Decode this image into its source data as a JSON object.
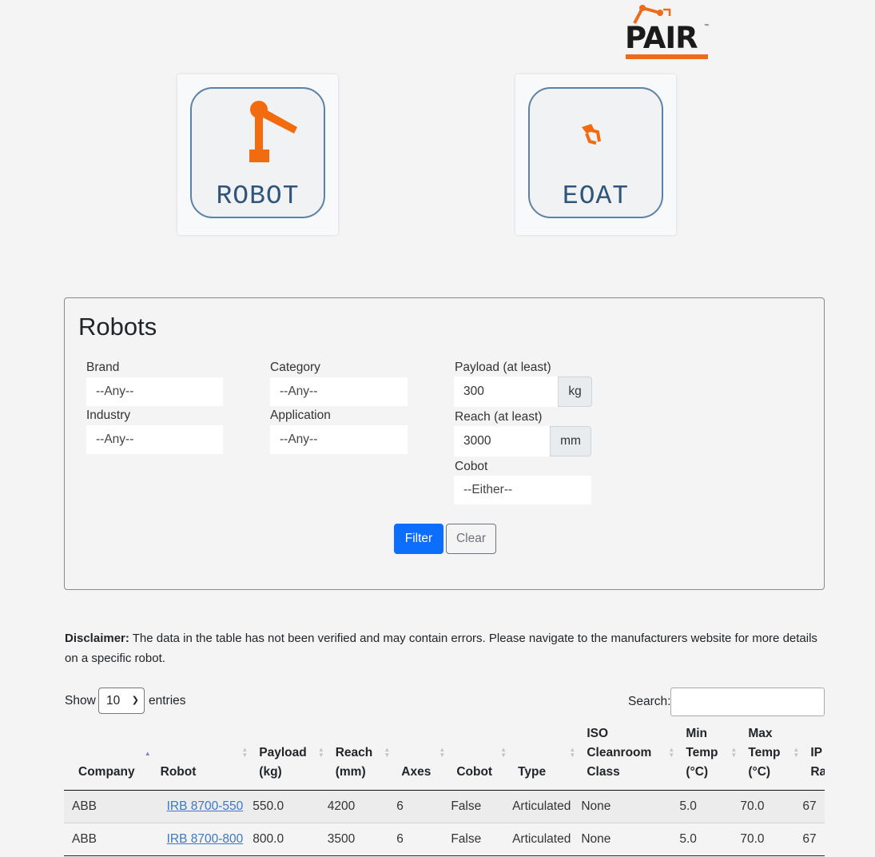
{
  "logo": {
    "text": "PAIR",
    "tm": "™"
  },
  "cards": [
    {
      "label": "ROBOT",
      "icon": "robot-arm-icon"
    },
    {
      "label": "EOAT",
      "icon": "gripper-icon"
    }
  ],
  "colors": {
    "accent": "#ef6b1c",
    "primary": "#0d6efd",
    "card_text": "#30557a",
    "link": "#3a78c9"
  },
  "filters": {
    "title": "Robots",
    "brand": {
      "label": "Brand",
      "value": "--Any--"
    },
    "industry": {
      "label": "Industry",
      "value": "--Any--"
    },
    "category": {
      "label": "Category",
      "value": "--Any--"
    },
    "application": {
      "label": "Application",
      "value": "--Any--"
    },
    "payload": {
      "label": "Payload (at least)",
      "value": "300",
      "unit": "kg"
    },
    "reach": {
      "label": "Reach (at least)",
      "value": "3000",
      "unit": "mm"
    },
    "cobot": {
      "label": "Cobot",
      "value": "--Either--"
    },
    "filter_label": "Filter",
    "clear_label": "Clear"
  },
  "disclaimer": {
    "bold": "Disclaimer:",
    "text": " The data in the table has not been verified and may contain errors. Please navigate to the manufacturers website for more details on a specific robot."
  },
  "table_controls": {
    "show_label": "Show",
    "entries_value": "10",
    "entries_label": "entries",
    "search_label": "Search:"
  },
  "table": {
    "headers": [
      "Company",
      "Robot",
      "Payload (kg)",
      "Reach (mm)",
      "Axes",
      "Cobot",
      "Type",
      "ISO Cleanroom Class",
      "Min Temp (°C)",
      "Max Temp (°C)",
      "IP Rating"
    ],
    "rows": [
      [
        "ABB",
        "IRB 8700-550",
        "550.0",
        "4200",
        "6",
        "False",
        "Articulated",
        "None",
        "5.0",
        "70.0",
        "67"
      ],
      [
        "ABB",
        "IRB 8700-800",
        "800.0",
        "3500",
        "6",
        "False",
        "Articulated",
        "None",
        "5.0",
        "70.0",
        "67"
      ]
    ]
  }
}
